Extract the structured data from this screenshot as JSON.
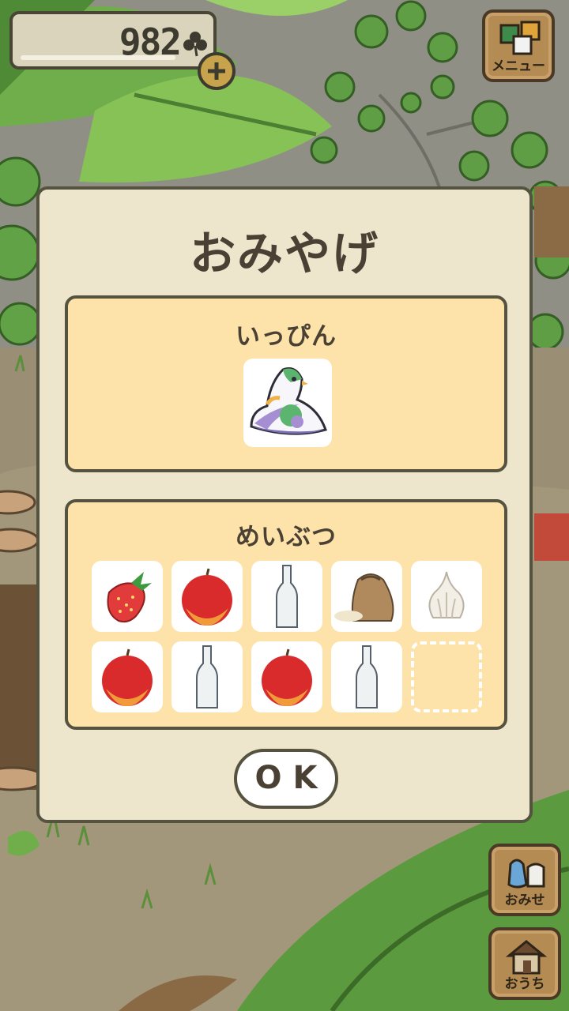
{
  "hud": {
    "clover_count": "982",
    "menu_label": "メニュー",
    "shop_label": "おみせ",
    "home_label": "おうち"
  },
  "dialog": {
    "title": "おみやげ",
    "specialty": {
      "heading": "いっぴん",
      "item": "pigeon-figurine"
    },
    "local_items": {
      "heading": "めいぶつ",
      "slots": [
        "strawberry",
        "apple",
        "bottle",
        "rice-sack",
        "garlic",
        "apple",
        "bottle",
        "apple",
        "bottle",
        "empty"
      ]
    },
    "ok_label": "OK"
  },
  "colors": {
    "dialog_bg": "#ede6cd",
    "panel_bg": "#fde3a9",
    "outline": "#55523f",
    "text": "#4a4134"
  }
}
